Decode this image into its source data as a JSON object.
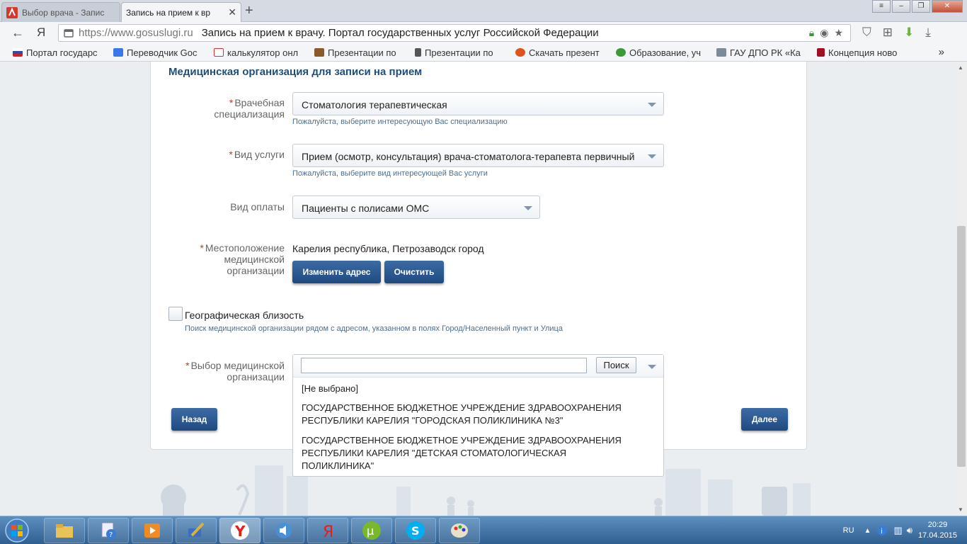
{
  "browser": {
    "tabs": [
      {
        "label": "Выбор врача - Запис"
      },
      {
        "label": "Запись на прием к вр"
      }
    ],
    "url": "https://www.gosuslugi.ru",
    "page_title": "Запись на прием к врачу. Портал государственных услуг Российской Федерации",
    "back_label": "←",
    "yandex_label": "Я",
    "bookmarks": [
      {
        "label": "Портал государс"
      },
      {
        "label": "Переводчик Goc"
      },
      {
        "label": "калькулятор онл"
      },
      {
        "label": "Презентации по"
      },
      {
        "label": "Презентации по"
      },
      {
        "label": "Скачать презент"
      },
      {
        "label": "Образование, уч"
      },
      {
        "label": "ГАУ ДПО РК «Ка"
      },
      {
        "label": "Концепция ново"
      }
    ],
    "bookmarks_more": "»"
  },
  "form": {
    "section_title": "Медицинская организация для записи на прием",
    "required_mark": "*",
    "specialization": {
      "label_line1": "Врачебная",
      "label_line2": "специализация",
      "value": "Стоматология терапевтическая",
      "hint": "Пожалуйста, выберите интересующую Вас специализацию"
    },
    "service": {
      "label": "Вид услуги",
      "value": "Прием (осмотр, консультация) врача-стоматолога-терапевта первичный",
      "hint": "Пожалуйста, выберите вид интересующей Вас услуги"
    },
    "payment": {
      "label": "Вид оплаты",
      "value": "Пациенты с полисами ОМС"
    },
    "location": {
      "label_line1": "Местоположение",
      "label_line2": "медицинской",
      "label_line3": "организации",
      "value": "Карелия республика, Петрозаводск город",
      "change_button": "Изменить адрес",
      "clear_button": "Очистить"
    },
    "geo": {
      "label": "Географическая близость",
      "hint": "Поиск медицинской организации рядом с адресом, указанном в полях Город/Населенный пункт и Улица",
      "checked": false
    },
    "organization": {
      "label_line1": "Выбор медицинской",
      "label_line2": "организации",
      "search_value": "",
      "search_button": "Поиск",
      "options": [
        {
          "line1": "[Не выбрано]"
        },
        {
          "line1": "ГОСУДАРСТВЕННОЕ БЮДЖЕТНОЕ УЧРЕЖДЕНИЕ ЗДРАВООХРАНЕНИЯ",
          "line2": "РЕСПУБЛИКИ КАРЕЛИЯ \"ГОРОДСКАЯ ПОЛИКЛИНИКА №3\""
        },
        {
          "line1": "ГОСУДАРСТВЕННОЕ БЮДЖЕТНОЕ УЧРЕЖДЕНИЕ ЗДРАВООХРАНЕНИЯ",
          "line2": "РЕСПУБЛИКИ КАРЕЛИЯ \"ДЕТСКАЯ СТОМАТОЛОГИЧЕСКАЯ",
          "line3": "ПОЛИКЛИНИКА\""
        }
      ]
    },
    "back_button": "Назад",
    "next_button": "Далее"
  },
  "taskbar": {
    "language": "RU",
    "time": "20:29",
    "date": "17.04.2015"
  },
  "colors": {
    "accent": "#1f4e7a",
    "button": "#2a5a93",
    "required": "#c0392b"
  }
}
